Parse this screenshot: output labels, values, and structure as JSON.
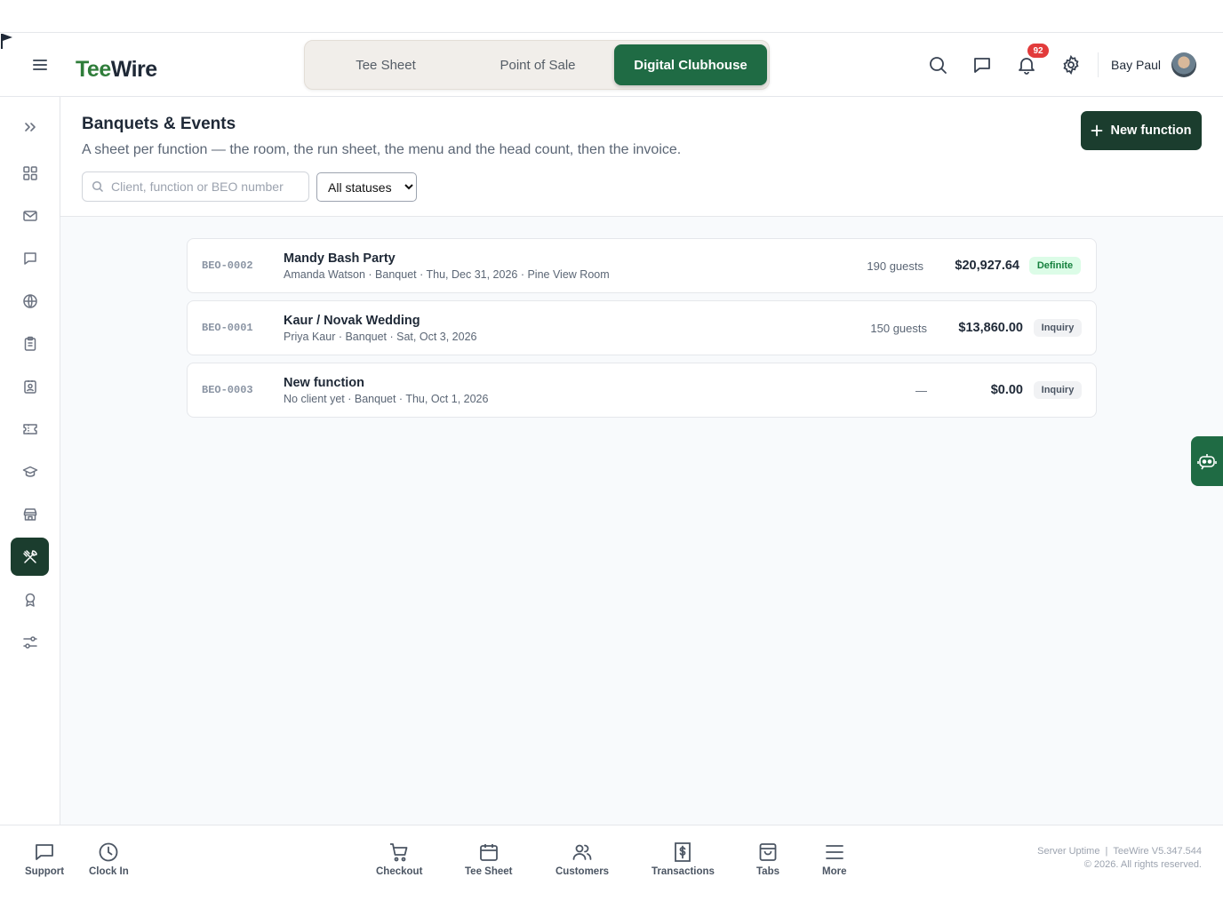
{
  "header": {
    "logo_tee": "Tee",
    "logo_wire": "Wire",
    "modes": [
      "Tee Sheet",
      "Point of Sale",
      "Digital Clubhouse"
    ],
    "active_mode": "Digital Clubhouse",
    "notifications_count": "92",
    "user_name": "Bay Paul"
  },
  "sidebar": {
    "icons": [
      "expand-icon",
      "dashboard-icon",
      "mail-icon",
      "chat-icon",
      "globe-icon",
      "clipboard-icon",
      "id-badge-icon",
      "ticket-icon",
      "graduation-cap-icon",
      "store-icon",
      "utensils-icon",
      "award-icon",
      "sliders-icon"
    ],
    "active": "utensils-icon"
  },
  "page": {
    "title": "Banquets & Events",
    "subtitle": "A sheet per function — the room, the run sheet, the menu and the head count, then the invoice.",
    "new_button": "New function",
    "search_placeholder": "Client, function or BEO number",
    "status_selected": "All statuses"
  },
  "functions": [
    {
      "beo": "BEO-0002",
      "name": "Mandy Bash Party",
      "meta": "Amanda Watson · Banquet · Thu, Dec 31, 2026 · Pine View Room",
      "guests": "190 guests",
      "amount": "$20,927.64",
      "status": "Definite"
    },
    {
      "beo": "BEO-0001",
      "name": "Kaur / Novak Wedding",
      "meta": "Priya Kaur · Banquet · Sat, Oct 3, 2026",
      "guests": "150 guests",
      "amount": "$13,860.00",
      "status": "Inquiry"
    },
    {
      "beo": "BEO-0003",
      "name": "New function",
      "meta": "No client yet · Banquet · Thu, Oct 1, 2026",
      "guests": "—",
      "amount": "$0.00",
      "status": "Inquiry"
    }
  ],
  "footer": {
    "left": [
      "Support",
      "Clock In"
    ],
    "center": [
      "Checkout",
      "Tee Sheet",
      "Customers",
      "Transactions",
      "Tabs",
      "More"
    ],
    "server_uptime": "Server Uptime",
    "version": "TeeWire V5.347.544",
    "copyright": "© 2026. All rights reserved."
  },
  "colors": {
    "brand_green": "#1f6b44",
    "dark_green": "#1b3d2e",
    "badge_red": "#e23b3b",
    "definite_bg": "#dcfce7",
    "definite_text": "#15803d"
  }
}
